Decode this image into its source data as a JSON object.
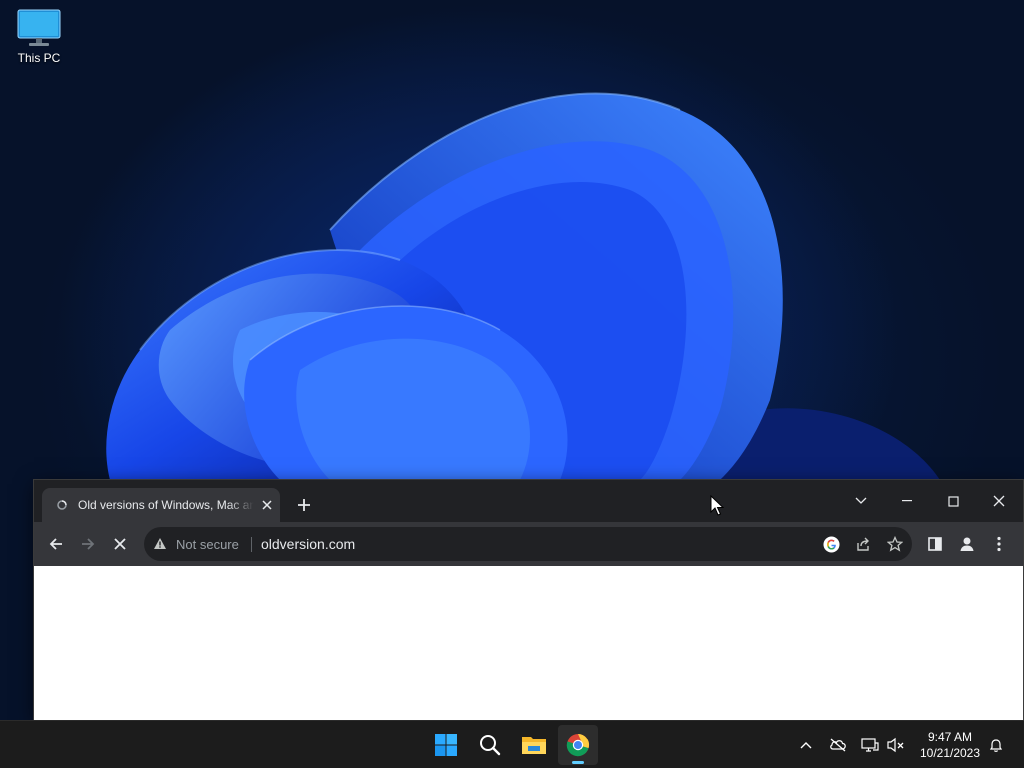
{
  "desktop": {
    "icons": [
      {
        "label": "This PC",
        "icon": "monitor-icon"
      }
    ]
  },
  "browser": {
    "tab": {
      "title": "Old versions of Windows, Mac and Linux software",
      "favicon": "loading-favicon-icon",
      "close_icon": "close-icon"
    },
    "new_tab_icon": "plus-icon",
    "window_controls": [
      "tab-search-icon",
      "minimize-icon",
      "maximize-icon",
      "close-icon"
    ],
    "toolbar": {
      "back_icon": "back-arrow-icon",
      "forward_icon": "forward-arrow-icon",
      "stop_icon": "stop-loading-icon",
      "security_label": "Not secure",
      "security_icon": "warning-triangle-icon",
      "url": "oldversion.com",
      "right_icons": [
        "google-icon",
        "share-icon",
        "bookmark-star-icon",
        "side-panel-icon",
        "profile-icon",
        "menu-kebab-icon"
      ]
    }
  },
  "taskbar": {
    "apps": [
      "windows-start-icon",
      "search-icon",
      "file-explorer-icon",
      "chrome-icon"
    ],
    "active_app": "chrome-icon",
    "tray_icons": [
      "chevron-up-icon",
      "onedrive-offline-icon",
      "network-display-icon",
      "volume-muted-icon"
    ],
    "clock": {
      "time": "9:47 AM",
      "date": "10/21/2023"
    },
    "notifications_icon": "bell-icon"
  },
  "colors": {
    "accent": "#60cdff",
    "tabstrip_bg": "#202124",
    "toolbar_bg": "#35363a",
    "taskbar_bg": "#1c1c1c",
    "bloom_blue": "#1a4dff"
  }
}
